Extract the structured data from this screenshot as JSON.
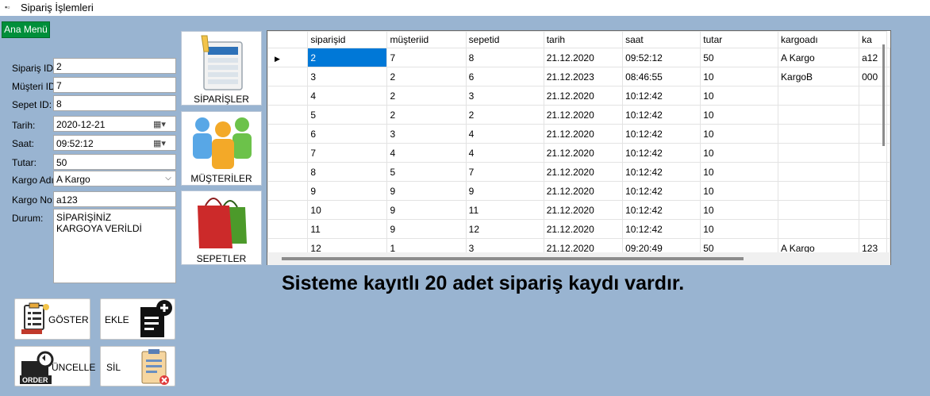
{
  "window": {
    "title": "Sipariş İşlemleri"
  },
  "buttons": {
    "ana_menu": "Ana Menü",
    "goster": "GÖSTER",
    "ekle": "EKLE",
    "guncelle": "ÜNCELLE",
    "sil": "SİL"
  },
  "form": {
    "siparis_id_label": "Sipariş ID:",
    "siparis_id_value": "2",
    "musteri_id_label": "Müşteri ID:",
    "musteri_id_value": "7",
    "sepet_id_label": "Sepet ID:",
    "sepet_id_value": "8",
    "tarih_label": "Tarih:",
    "tarih_value": "2020-12-21",
    "saat_label": "Saat:",
    "saat_value": "09:52:12",
    "tutar_label": "Tutar:",
    "tutar_value": "50",
    "kargo_adi_label": "Kargo Adı:",
    "kargo_adi_value": "A Kargo",
    "kargo_no_label": "Kargo No:",
    "kargo_no_value": "a123",
    "durum_label": "Durum:",
    "durum_value": "SİPARİŞİNİZ KARGOYA VERİLDİ"
  },
  "tiles": {
    "siparisler": "SİPARİŞLER",
    "musteriler": "MÜŞTERİLER",
    "sepetler": "SEPETLER"
  },
  "grid": {
    "columns": [
      "siparişid",
      "müşteriid",
      "sepetid",
      "tarih",
      "saat",
      "tutar",
      "kargoadı",
      "ka"
    ],
    "rows": [
      [
        "2",
        "7",
        "8",
        "21.12.2020",
        "09:52:12",
        "50",
        "A Kargo",
        "a12"
      ],
      [
        "3",
        "2",
        "6",
        "21.12.2023",
        "08:46:55",
        "10",
        "KargoB",
        "000"
      ],
      [
        "4",
        "2",
        "3",
        "21.12.2020",
        "10:12:42",
        "10",
        "",
        ""
      ],
      [
        "5",
        "2",
        "2",
        "21.12.2020",
        "10:12:42",
        "10",
        "",
        ""
      ],
      [
        "6",
        "3",
        "4",
        "21.12.2020",
        "10:12:42",
        "10",
        "",
        ""
      ],
      [
        "7",
        "4",
        "4",
        "21.12.2020",
        "10:12:42",
        "10",
        "",
        ""
      ],
      [
        "8",
        "5",
        "7",
        "21.12.2020",
        "10:12:42",
        "10",
        "",
        ""
      ],
      [
        "9",
        "9",
        "9",
        "21.12.2020",
        "10:12:42",
        "10",
        "",
        ""
      ],
      [
        "10",
        "9",
        "11",
        "21.12.2020",
        "10:12:42",
        "10",
        "",
        ""
      ],
      [
        "11",
        "9",
        "12",
        "21.12.2020",
        "10:12:42",
        "10",
        "",
        ""
      ],
      [
        "12",
        "1",
        "3",
        "21.12.2020",
        "09:20:49",
        "50",
        "A Kargo",
        "123"
      ]
    ]
  },
  "info_text": "Sisteme kayıtlı 20 adet sipariş kaydı vardır.",
  "colors": {
    "background": "#99b4d1",
    "accent_green": "#008f3a",
    "selection": "#0078d7"
  }
}
